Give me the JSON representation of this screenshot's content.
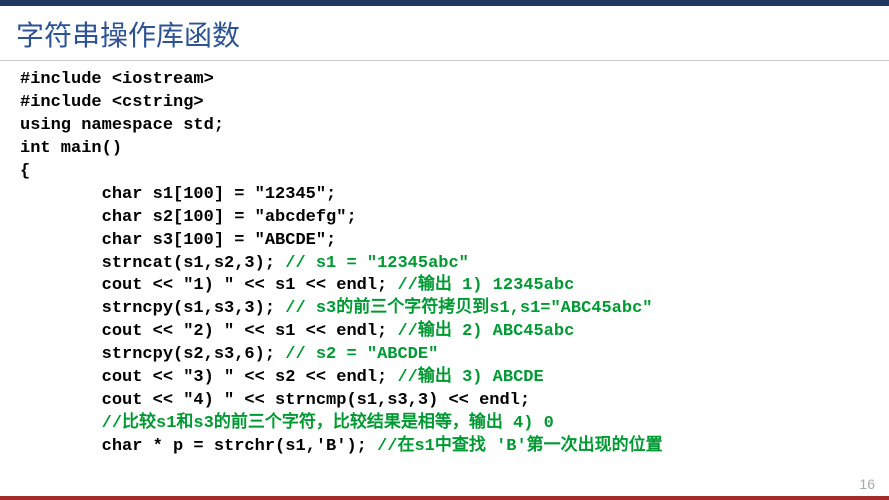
{
  "title": "字符串操作库函数",
  "code": {
    "lines": [
      {
        "text": "#include <iostream>",
        "comment": "",
        "indent": 0
      },
      {
        "text": "#include <cstring>",
        "comment": "",
        "indent": 0
      },
      {
        "text": "using namespace std;",
        "comment": "",
        "indent": 0
      },
      {
        "text": "int main()",
        "comment": "",
        "indent": 0
      },
      {
        "text": "{",
        "comment": "",
        "indent": 0
      },
      {
        "text": "char s1[100] = \"12345\";",
        "comment": "",
        "indent": 1
      },
      {
        "text": "char s2[100] = \"abcdefg\";",
        "comment": "",
        "indent": 1
      },
      {
        "text": "char s3[100] = \"ABCDE\";",
        "comment": "",
        "indent": 1
      },
      {
        "text": "strncat(s1,s2,3); ",
        "comment": "// s1 = \"12345abc\"",
        "indent": 1
      },
      {
        "text": "cout << \"1) \" << s1 << endl; ",
        "comment": "//输出 1) 12345abc",
        "indent": 1
      },
      {
        "text": "strncpy(s1,s3,3); ",
        "comment": "// s3的前三个字符拷贝到s1,s1=\"ABC45abc\"",
        "indent": 1
      },
      {
        "text": "cout << \"2) \" << s1 << endl; ",
        "comment": "//输出 2) ABC45abc",
        "indent": 1
      },
      {
        "text": "strncpy(s2,s3,6); ",
        "comment": "// s2 = \"ABCDE\"",
        "indent": 1
      },
      {
        "text": "cout << \"3) \" << s2 << endl; ",
        "comment": "//输出 3) ABCDE",
        "indent": 1
      },
      {
        "text": "cout << \"4) \" << strncmp(s1,s3,3) << endl;",
        "comment": "",
        "indent": 1
      },
      {
        "text": "",
        "comment": "//比较s1和s3的前三个字符，比较结果是相等，输出 4) 0",
        "indent": 1
      },
      {
        "text": "char * p = strchr(s1,'B'); ",
        "comment": "//在s1中查找 'B'第一次出现的位置",
        "indent": 1
      }
    ]
  },
  "pageNumber": "16"
}
